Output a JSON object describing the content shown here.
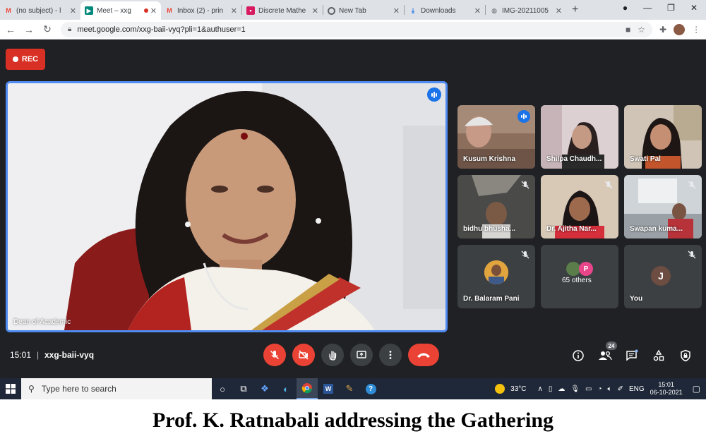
{
  "browser": {
    "tabs": [
      {
        "title": "(no subject) - l",
        "favicon": "gmail-icon"
      },
      {
        "title": "Meet – xxg",
        "favicon": "meet-icon",
        "active": true,
        "recording": true
      },
      {
        "title": "Inbox (2) - prin",
        "favicon": "gmail-icon"
      },
      {
        "title": "Discrete Mathe",
        "favicon": "bookmark-icon"
      },
      {
        "title": "New Tab",
        "favicon": "chrome-icon"
      },
      {
        "title": "Downloads",
        "favicon": "download-icon"
      },
      {
        "title": "IMG-20211005",
        "favicon": "globe-icon"
      }
    ],
    "url": "meet.google.com/xxg-baii-vyq?pli=1&authuser=1"
  },
  "meet": {
    "rec_label": "REC",
    "main_speaker_label": "Dean of Academic",
    "time": "15:01",
    "meeting_code": "xxg-baii-vyq",
    "participant_count": "24",
    "tiles": [
      {
        "name": "Kusum Krishna",
        "speaking": true
      },
      {
        "name": "Shilpa Chaudh..."
      },
      {
        "name": "Swati Pal"
      },
      {
        "name": "bidhu bhusha...",
        "muted": true
      },
      {
        "name": "Dr. Ajitha Nar...",
        "muted": true
      },
      {
        "name": "Swapan kuma...",
        "muted": true
      },
      {
        "name": "Dr. Balaram Pani",
        "muted": true
      },
      {
        "name": "65 others",
        "avatar_letter": "P"
      },
      {
        "name": "You",
        "muted": true,
        "avatar_letter": "J"
      }
    ]
  },
  "taskbar": {
    "search_placeholder": "Type here to search",
    "weather": "33°C",
    "language": "ENG",
    "time": "15:01",
    "date": "06-10-2021"
  },
  "caption": "Prof. K. Ratnabali addressing the Gathering",
  "colors": {
    "meet_bg": "#202124",
    "accent_blue": "#1a73e8",
    "red": "#ea4335",
    "tile_bg": "#3c4043"
  }
}
